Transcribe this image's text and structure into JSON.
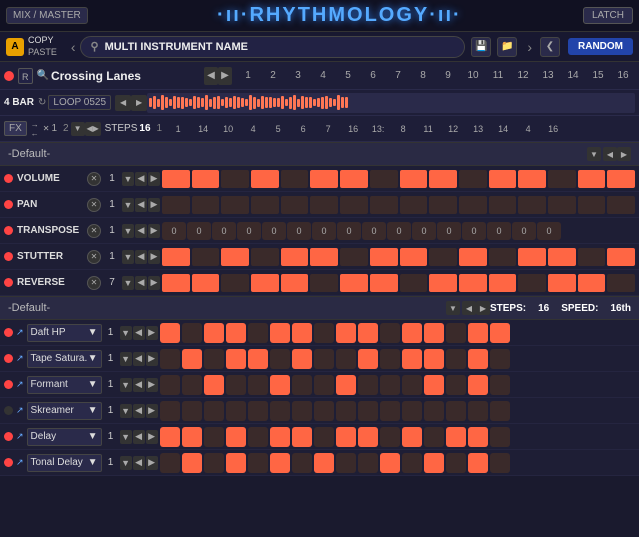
{
  "topBar": {
    "mixMaster": "MIX / MASTER",
    "logo": "·ıı·RHYTHMOLOGY·ıı·",
    "latch": "LATCH"
  },
  "secondBar": {
    "aLabel": "A",
    "copy": "COPY",
    "paste": "PASTE",
    "instrumentName": "MULTI INSTRUMENT NAME",
    "random": "RANDOM"
  },
  "row1": {
    "presetName": "Crossing Lanes",
    "rLabel": "R",
    "stepNumbers": [
      "1",
      "2",
      "3",
      "4",
      "5",
      "6",
      "7",
      "8",
      "9",
      "10",
      "11",
      "12",
      "13",
      "14",
      "15",
      "16"
    ]
  },
  "row2": {
    "barLabel": "4 BAR",
    "loopName": "LOOP 0525"
  },
  "row3": {
    "fxLabel": "FX",
    "stepsLabel": "STEPS",
    "stepsVal": "16",
    "stepVals": [
      "1",
      "14",
      "10",
      "4",
      "5",
      "6",
      "7",
      "16",
      "13:",
      "8",
      "11",
      "12",
      "13",
      "14",
      "4",
      "16"
    ]
  },
  "defaultSection": {
    "label": "-Default-"
  },
  "params": [
    {
      "name": "VOLUME",
      "val": "1",
      "active": true
    },
    {
      "name": "PAN",
      "val": "1",
      "active": true
    },
    {
      "name": "TRANSPOSE",
      "val": "1",
      "active": true,
      "stepVals": [
        "0",
        "0",
        "0",
        "0",
        "0",
        "0",
        "0",
        "0",
        "0",
        "0",
        "0",
        "0",
        "0",
        "0",
        "0",
        "0"
      ]
    },
    {
      "name": "STUTTER",
      "val": "1",
      "active": true
    },
    {
      "name": "REVERSE",
      "val": "7",
      "active": true
    }
  ],
  "bottomSection": {
    "label": "-Default-",
    "stepsLabel": "STEPS:",
    "stepsVal": "16",
    "speedLabel": "SPEED:",
    "speedVal": "16th"
  },
  "instruments": [
    {
      "name": "Daft HP",
      "val": "1",
      "led": true
    },
    {
      "name": "Tape Satura.",
      "val": "1",
      "led": true
    },
    {
      "name": "Formant",
      "val": "1",
      "led": true
    },
    {
      "name": "Skreamer",
      "val": "1",
      "led": false
    },
    {
      "name": "Delay",
      "val": "1",
      "led": true
    },
    {
      "name": "Tonal Delay",
      "val": "1",
      "led": true
    }
  ]
}
